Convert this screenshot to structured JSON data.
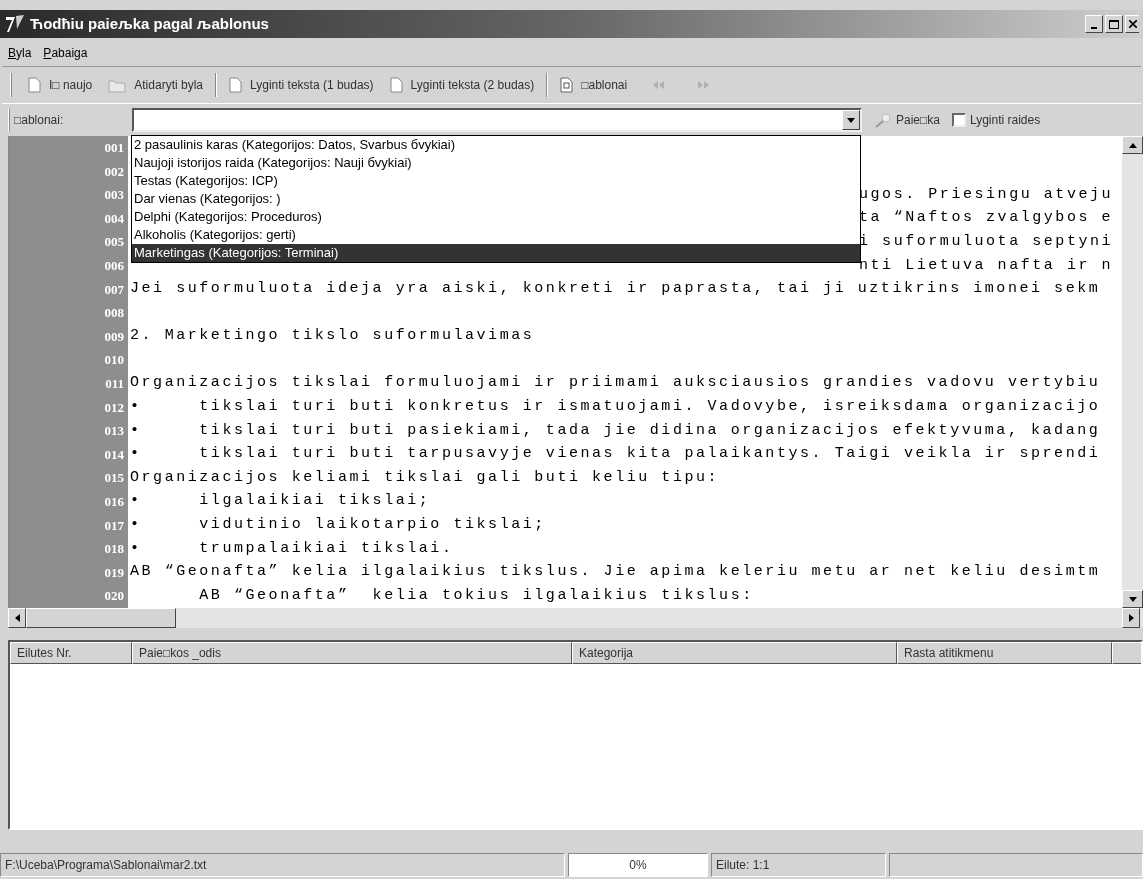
{
  "window": {
    "title": "Ћodħiu paieљka pagal љablonus"
  },
  "menu": [
    {
      "label": "Byla"
    },
    {
      "label": "Pabaiga"
    }
  ],
  "toolbar": [
    {
      "kind": "new",
      "label": "I□ naujo"
    },
    {
      "kind": "open",
      "label": "Atidaryti byla"
    },
    {
      "kind": "compare",
      "label": "Lyginti teksta (1 budas)"
    },
    {
      "kind": "compare",
      "label": "Lyginti teksta (2 budas)"
    },
    {
      "kind": "templates",
      "label": "□ablonai"
    },
    {
      "kind": "back",
      "disabled": true
    },
    {
      "kind": "forward",
      "disabled": true
    }
  ],
  "search_row": {
    "label": "□ablonai:",
    "search_button": "Paie□ka",
    "checkbox": {
      "label": "Lyginti raides",
      "checked": false
    }
  },
  "dropdown": [
    {
      "label": "2 pasaulinis karas (Kategorijos: Datos, Svarbus бvykiai)",
      "selected": false
    },
    {
      "label": "Naujoji istorijos raida (Kategorijos: Nauji бvykiai)",
      "selected": false
    },
    {
      "label": "Testas (Kategorijos: ICP)",
      "selected": false
    },
    {
      "label": "Dar vienas (Kategorijos: )",
      "selected": false
    },
    {
      "label": "Delphi (Kategorijos: Proceduros)",
      "selected": false
    },
    {
      "label": "Alkoholis (Kategorijos: gerti)",
      "selected": false
    },
    {
      "label": "Marketingas (Kategorijos: Terminai)",
      "selected": true
    }
  ],
  "editor_lines": [
    {
      "number": "001"
    },
    {
      "number": "002"
    },
    {
      "number": "003",
      "covered": true,
      "text": "ugos. Priesingu atveju"
    },
    {
      "number": "004",
      "covered": true,
      "text": "ta “Naftos zvalgybos e"
    },
    {
      "number": "005",
      "covered": true,
      "text": "i suformuluota septyni"
    },
    {
      "number": "006",
      "covered": true,
      "text": "nti Lietuva nafta ir n"
    },
    {
      "number": "007",
      "covered": false,
      "text": "Jei suformuluota ideja yra aiski, konkreti ir paprasta, tai ji uztikrins imonei sekm"
    },
    {
      "number": "008"
    },
    {
      "number": "009",
      "covered": false,
      "text": "2. Marketingo tikslo suformulavimas"
    },
    {
      "number": "010"
    },
    {
      "number": "011",
      "covered": false,
      "text": "Organizacijos tikslai formuluojami ir priimami auksciausios grandies vadovu vertybiu"
    },
    {
      "number": "012",
      "covered": false,
      "text": "•     tikslai turi buti konkretus ir ismatuojami. Vadovybe, isreiksdama organizacijo"
    },
    {
      "number": "013",
      "covered": false,
      "text": "•     tikslai turi buti pasiekiami, tada jie didina organizacijos efektyvuma, kadang"
    },
    {
      "number": "014",
      "covered": false,
      "text": "•     tikslai turi buti tarpusavyje vienas kita palaikantys. Taigi veikla ir sprendi"
    },
    {
      "number": "015",
      "covered": false,
      "text": "Organizacijos keliami tikslai gali buti keliu tipu:"
    },
    {
      "number": "016",
      "covered": false,
      "text": "•     ilgalaikiai tikslai;"
    },
    {
      "number": "017",
      "covered": false,
      "text": "•     vidutinio laikotarpio tikslai;"
    },
    {
      "number": "018",
      "covered": false,
      "text": "•     trumpalaikiai tikslai."
    },
    {
      "number": "019",
      "covered": false,
      "text": "AB “Geonafta” kelia ilgalaikius tikslus. Jie apima keleriu metu ar net keliu desimtm"
    },
    {
      "number": "020",
      "covered": false,
      "text": "      AB “Geonafta”  kelia tokius ilgalaikius tikslus:"
    }
  ],
  "results_table": {
    "columns": [
      "Eilutes Nr.",
      "Paie□kos _odis",
      "Kategorija",
      "Rasta atitikmenu"
    ]
  },
  "status_bar": {
    "path": "F:\\Uceba\\Programa\\Sablonai\\mar2.txt",
    "progress": "0%",
    "position": "Eilute: 1:1"
  }
}
